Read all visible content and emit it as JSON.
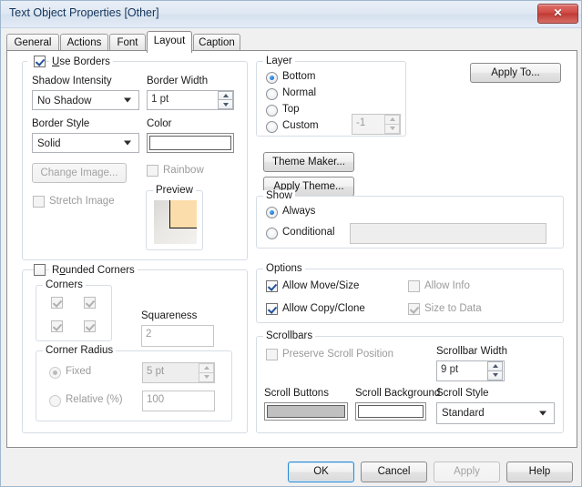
{
  "window": {
    "title": "Text Object Properties [Other]",
    "close_icon": "close-icon",
    "close_label": "✕"
  },
  "tabs": [
    {
      "label": "General",
      "active": false
    },
    {
      "label": "Actions",
      "active": false
    },
    {
      "label": "Font",
      "active": false
    },
    {
      "label": "Layout",
      "active": true
    },
    {
      "label": "Caption",
      "active": false
    }
  ],
  "use_borders": {
    "legend": "Use Borders",
    "checked": true,
    "shadow_intensity_label": "Shadow Intensity",
    "shadow_intensity_value": "No Shadow",
    "border_width_label": "Border Width",
    "border_width_value": "1 pt",
    "border_style_label": "Border Style",
    "border_style_value": "Solid",
    "color_label": "Color",
    "color_value": "#ffffff",
    "change_image_label": "Change Image...",
    "stretch_image_label": "Stretch Image",
    "rainbow_label": "Rainbow",
    "preview_legend": "Preview"
  },
  "rounded_corners": {
    "legend": "Rounded Corners",
    "checked": false,
    "corners_legend": "Corners",
    "corners": [
      {
        "name": "top-left",
        "checked": true
      },
      {
        "name": "top-right",
        "checked": true
      },
      {
        "name": "bottom-left",
        "checked": true
      },
      {
        "name": "bottom-right",
        "checked": true
      }
    ],
    "squareness_label": "Squareness",
    "squareness_value": "2",
    "corner_radius_legend": "Corner Radius",
    "fixed_label": "Fixed",
    "fixed_value": "5 pt",
    "relative_label": "Relative (%)",
    "relative_value": "100"
  },
  "layer": {
    "legend": "Layer",
    "options": [
      {
        "label": "Bottom",
        "selected": true
      },
      {
        "label": "Normal",
        "selected": false
      },
      {
        "label": "Top",
        "selected": false
      },
      {
        "label": "Custom",
        "selected": false
      }
    ],
    "custom_value": "-1"
  },
  "apply_to_label": "Apply To...",
  "theme_maker_label": "Theme Maker...",
  "apply_theme_label": "Apply Theme...",
  "show": {
    "legend": "Show",
    "always_label": "Always",
    "always_selected": true,
    "conditional_label": "Conditional",
    "conditional_selected": false,
    "conditional_value": ""
  },
  "options": {
    "legend": "Options",
    "allow_move_size_label": "Allow Move/Size",
    "allow_move_size_checked": true,
    "allow_copy_clone_label": "Allow Copy/Clone",
    "allow_copy_clone_checked": true,
    "allow_info_label": "Allow Info",
    "allow_info_checked": false,
    "size_to_data_label": "Size to Data",
    "size_to_data_checked": true
  },
  "scrollbars": {
    "legend": "Scrollbars",
    "preserve_scroll_label": "Preserve Scroll Position",
    "preserve_scroll_checked": false,
    "scrollbar_width_label": "Scrollbar Width",
    "scrollbar_width_value": "9 pt",
    "scroll_buttons_label": "Scroll Buttons",
    "scroll_buttons_color": "#c0c0c0",
    "scroll_background_label": "Scroll Background",
    "scroll_background_color": "#ffffff",
    "scroll_style_label": "Scroll Style",
    "scroll_style_value": "Standard"
  },
  "footer": {
    "ok_label": "OK",
    "cancel_label": "Cancel",
    "apply_label": "Apply",
    "apply_enabled": false,
    "help_label": "Help"
  }
}
